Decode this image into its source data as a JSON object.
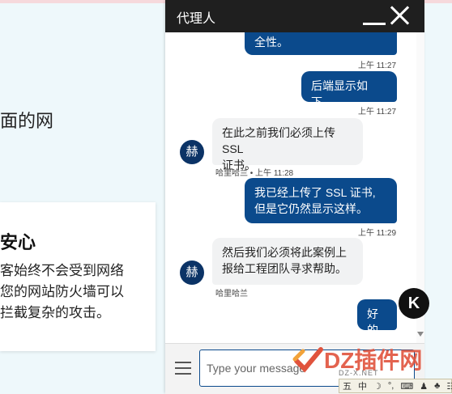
{
  "background": {
    "heading": "面的网",
    "card_title": "安心",
    "card_lines": [
      "客始终不会受到网络",
      "您的网站防火墙可以",
      "拦截复杂的攻击。"
    ]
  },
  "chat": {
    "title": "代理人",
    "messages": [
      {
        "dir": "out",
        "text": "全性。",
        "time": "上午 11:27"
      },
      {
        "dir": "out",
        "text": "后端显示如下。",
        "time": "上午 11:27"
      },
      {
        "dir": "in",
        "text_lines": [
          "在此之前我们必须上传SSL",
          "证书。"
        ],
        "meta": "哈里哈兰 • 上午 11:28",
        "avatar": "赫"
      },
      {
        "dir": "out",
        "text_lines": [
          "我已经上传了 SSL 证书,",
          "但是它仍然显示这样。"
        ],
        "time": "上午 11:29"
      },
      {
        "dir": "in",
        "text_lines": [
          "然后我们必须将此案例上",
          "报给工程团队寻求帮助。"
        ],
        "meta": "哈里哈兰",
        "avatar": "赫"
      },
      {
        "dir": "out",
        "text": "好的"
      }
    ],
    "input_placeholder": "Type your message"
  },
  "badge_letter": "K",
  "watermark": {
    "text": "DZ插件网",
    "sub": "DZ-X.NET"
  },
  "ime": {
    "items": [
      "五",
      "中",
      "☽",
      "°,",
      "⌨",
      "♟",
      "♣",
      "☷"
    ]
  },
  "colors": {
    "outgoing": "#0b4a8c",
    "incoming": "#f1f2f3",
    "header": "#1f1f1f",
    "avatar": "#0b3366"
  }
}
